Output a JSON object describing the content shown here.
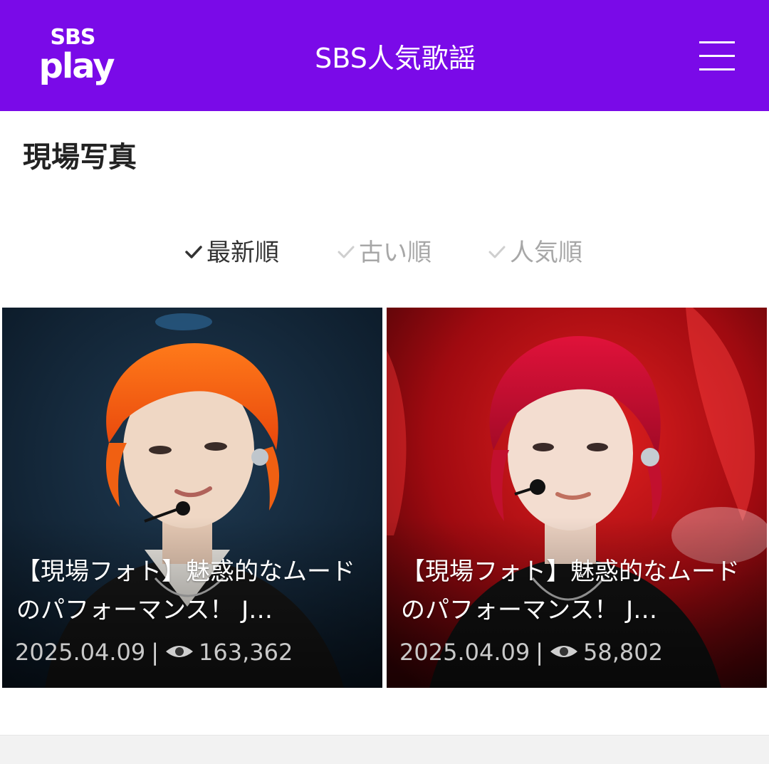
{
  "header": {
    "logo_top": "SBS",
    "logo_bottom": "play",
    "title": "SBS人気歌謡",
    "menu_icon": "hamburger-icon",
    "background_color": "#7a0ae8"
  },
  "section": {
    "title": "現場写真"
  },
  "sort": {
    "options": [
      {
        "label": "最新順",
        "active": true
      },
      {
        "label": "古い順",
        "active": false
      },
      {
        "label": "人気順",
        "active": false
      }
    ]
  },
  "cards": [
    {
      "title": "【現場フォト】魅惑的なムードのパフォーマンス！ J…",
      "date": "2025.04.09",
      "views": "163,362",
      "image": "performer with orange hair and headset microphone on dark stage"
    },
    {
      "title": "【現場フォト】魅惑的なムードのパフォーマンス！ J…",
      "date": "2025.04.09",
      "views": "58,802",
      "image": "performer with red hair and headset microphone in front of red stage lights"
    }
  ]
}
